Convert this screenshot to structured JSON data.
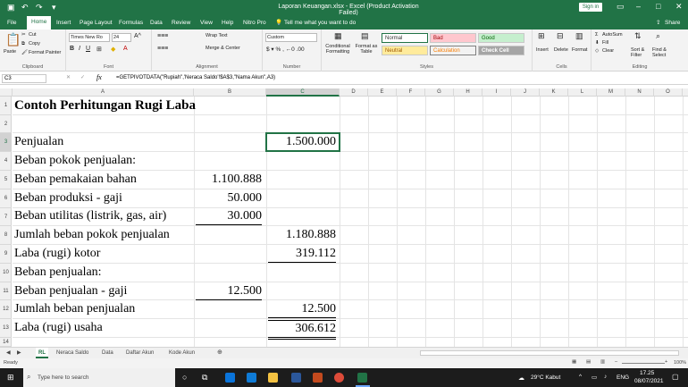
{
  "titlebar": {
    "title": "Laporan Keuangan.xlsx  -  Excel (Product Activation Failed)",
    "signin": "Sign in"
  },
  "ribbon_tabs": [
    "File",
    "Home",
    "Insert",
    "Page Layout",
    "Formulas",
    "Data",
    "Review",
    "View",
    "Help",
    "Nitro Pro"
  ],
  "tell_me": "Tell me what you want to do",
  "share": "Share",
  "clipboard": {
    "paste": "Paste",
    "cut": "Cut",
    "copy": "Copy",
    "format_painter": "Format Painter",
    "label": "Clipboard"
  },
  "font": {
    "name": "Times New Ro",
    "size": "24",
    "label": "Font"
  },
  "alignment": {
    "wrap": "Wrap Text",
    "merge": "Merge & Center",
    "label": "Alignment"
  },
  "number": {
    "format": "Custom",
    "label": "Number"
  },
  "styles": {
    "conditional": "Conditional Formatting",
    "format_table": "Format as Table",
    "normal": "Normal",
    "bad": "Bad",
    "good": "Good",
    "neutral": "Neutral",
    "calculation": "Calculation",
    "check_cell": "Check Cell",
    "label": "Styles"
  },
  "cells": {
    "insert": "Insert",
    "delete": "Delete",
    "format": "Format",
    "label": "Cells"
  },
  "editing": {
    "autosum": "AutoSum",
    "fill": "Fill",
    "clear": "Clear",
    "sort": "Sort & Filter",
    "find": "Find & Select",
    "label": "Editing"
  },
  "namebox": "C3",
  "formula": "=GETPIVOTDATA(\"Rupiah\",'Neraca Saldo'!$A$3,\"Nama Akun\",A3)",
  "columns": [
    "A",
    "B",
    "C",
    "D",
    "E",
    "F",
    "G",
    "H",
    "I",
    "J",
    "K",
    "L",
    "M",
    "N",
    "O"
  ],
  "rows": [
    "1",
    "2",
    "3",
    "4",
    "5",
    "6",
    "7",
    "8",
    "9",
    "10",
    "11",
    "12",
    "13",
    "14"
  ],
  "cells_data": {
    "r1": "Contoh Perhitungan Rugi Laba",
    "r3a": "Penjualan",
    "r3c": "1.500.000",
    "r4a": "Beban pokok penjualan:",
    "r5a": "Beban pemakaian bahan",
    "r5b": "1.100.888",
    "r6a": "Beban produksi - gaji",
    "r6b": "50.000",
    "r7a": "Beban utilitas (listrik, gas, air)",
    "r7b": "30.000",
    "r8a": "Jumlah beban pokok penjualan",
    "r8c": "1.180.888",
    "r9a": "Laba (rugi) kotor",
    "r9c": "319.112",
    "r10a": "Beban penjualan:",
    "r11a": "Beban penjualan - gaji",
    "r11b": "12.500",
    "r12a": "Jumlah beban penjualan",
    "r12c": "12.500",
    "r13a": "Laba (rugi) usaha",
    "r13c": "306.612"
  },
  "sheets": [
    "RL",
    "Neraca Saldo",
    "Data",
    "Daftar Akun",
    "Kode Akun"
  ],
  "status": {
    "ready": "Ready",
    "zoom": "100%"
  },
  "taskbar": {
    "search": "Type here to search",
    "weather": "29°C  Kabut",
    "lang": "ENG",
    "time": "17.25",
    "date": "08/07/2021"
  },
  "colors": {
    "accent": "#217346",
    "selected": "#d2d2d2"
  }
}
